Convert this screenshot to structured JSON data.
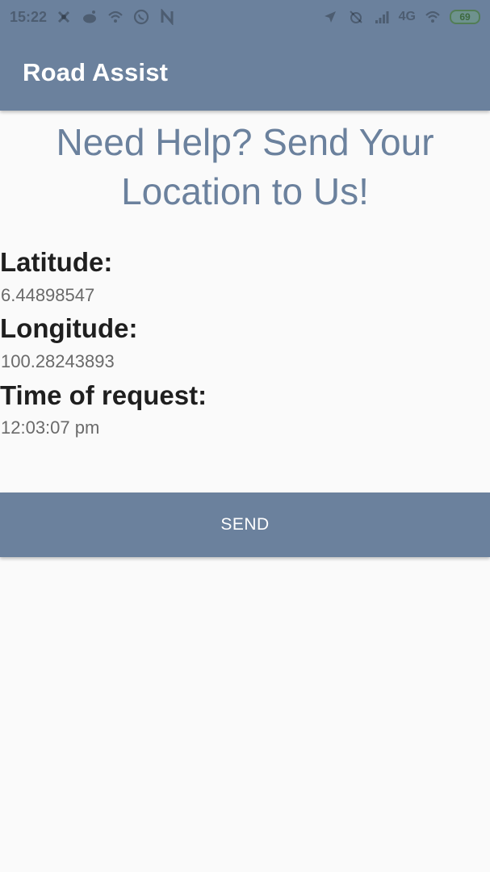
{
  "status_bar": {
    "time": "15:22",
    "network": "4G",
    "battery": "69",
    "left_icons": [
      "notification-icon",
      "reddit-icon",
      "wifi-icon",
      "whatsapp-icon",
      "n-icon"
    ],
    "right_icons": [
      "location-icon",
      "alarm-off-icon",
      "signal-icon",
      "wifi-icon",
      "battery-icon"
    ]
  },
  "app_bar": {
    "title": "Road Assist",
    "color": "#6b819d"
  },
  "main": {
    "headline_line1": "Need Help? Send Your",
    "headline_line2": "Location to Us!",
    "latitude_label": "Latitude:",
    "latitude_value": "6.44898547",
    "longitude_label": "Longitude:",
    "longitude_value": "100.28243893",
    "time_label": "Time of request:",
    "time_value": "12:03:07 pm"
  },
  "actions": {
    "send_label": "SEND"
  }
}
